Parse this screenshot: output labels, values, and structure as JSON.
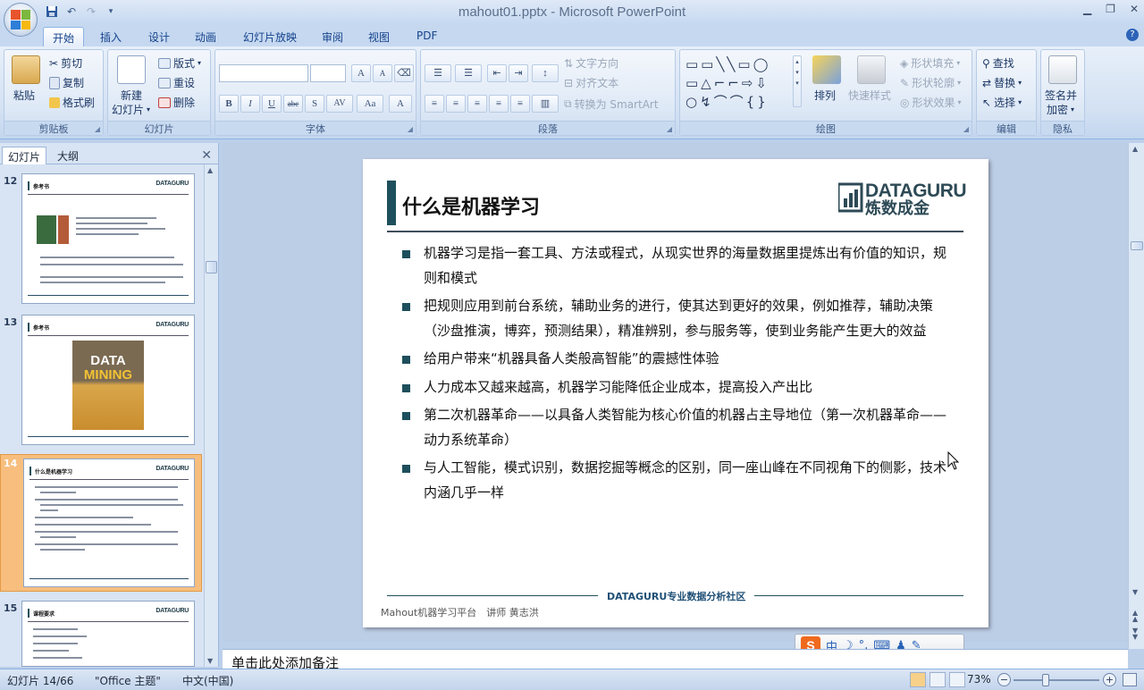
{
  "window": {
    "title": "mahout01.pptx - Microsoft PowerPoint"
  },
  "ribbon_tabs": [
    "开始",
    "插入",
    "设计",
    "动画",
    "幻灯片放映",
    "审阅",
    "视图",
    "PDF"
  ],
  "clipboard": {
    "paste": "粘贴",
    "cut": "剪切",
    "copy": "复制",
    "format_painter": "格式刷",
    "group": "剪贴板"
  },
  "slides_group": {
    "new_slide_1": "新建",
    "new_slide_2": "幻灯片",
    "layout": "版式",
    "reset": "重设",
    "delete": "删除",
    "group": "幻灯片"
  },
  "font_group": {
    "group": "字体",
    "bold": "B",
    "italic": "I",
    "underline": "U",
    "strike": "abc",
    "shadow": "S",
    "spacing": "AV",
    "case": "Aa",
    "color": "A"
  },
  "paragraph_group": {
    "group": "段落",
    "text_direction": "文字方向",
    "align_text": "对齐文本",
    "smartart": "转换为 SmartArt"
  },
  "drawing_group": {
    "group": "绘图",
    "arrange": "排列",
    "quick_styles": "快速样式",
    "shape_fill": "形状填充",
    "shape_outline": "形状轮廓",
    "shape_effects": "形状效果"
  },
  "editing_group": {
    "group": "编辑",
    "find": "查找",
    "replace": "替换",
    "select": "选择"
  },
  "privacy_group": {
    "group": "隐私",
    "sign_1": "签名并",
    "sign_2": "加密"
  },
  "panel": {
    "tab_slides": "幻灯片",
    "tab_outline": "大纲",
    "close": "✕"
  },
  "thumbnails": [
    {
      "num": "12",
      "title": "参考书"
    },
    {
      "num": "13",
      "title": "参考书",
      "cover_1": "DATA",
      "cover_2": "MINING"
    },
    {
      "num": "14",
      "title": "什么是机器学习"
    },
    {
      "num": "15",
      "title": "课程要求"
    }
  ],
  "thumb_logo": "DATAGURU",
  "slide": {
    "title": "什么是机器学习",
    "logo_en": "DATAGURU",
    "logo_cn": "炼数成金",
    "bullets": [
      "机器学习是指一套工具、方法或程式，从现实世界的海量数据里提炼出有价值的知识，规则和模式",
      "把规则应用到前台系统，辅助业务的进行，使其达到更好的效果，例如推荐，辅助决策（沙盘推演，博弈，预测结果），精准辨别，参与服务等，使到业务能产生更大的效益",
      "给用户带来“机器具备人类般高智能”的震撼性体验",
      "人力成本又越来越高，机器学习能降低企业成本，提高投入产出比",
      "第二次机器革命——以具备人类智能为核心价值的机器占主导地位（第一次机器革命——动力系统革命）",
      "与人工智能，模式识别，数据挖掘等概念的区别，同一座山峰在不同视角下的侧影，技术内涵几乎一样"
    ],
    "footer_center": "DATAGURU专业数据分析社区",
    "footer_left": "Mahout机器学习平台　讲师 黄志洪"
  },
  "notes": {
    "placeholder": "单击此处添加备注"
  },
  "ime": {
    "lang": "中"
  },
  "status": {
    "slide_pos": "幻灯片 14/66",
    "theme": "\"Office 主题\"",
    "lang": "中文(中国)",
    "zoom": "73%"
  }
}
